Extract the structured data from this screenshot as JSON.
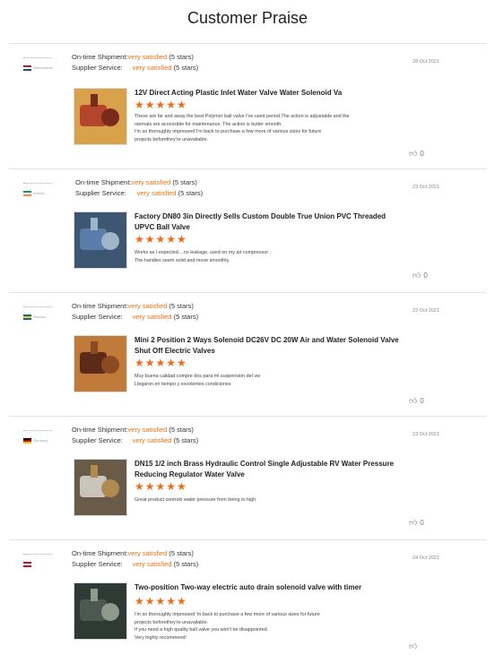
{
  "page": {
    "title": "Customer Praise"
  },
  "labels": {
    "shipment": "On-time Shipment:",
    "service": "Supplier Service:"
  },
  "reviews": [
    {
      "country": "Netherlands",
      "flag": [
        "#ae1c28",
        "#ffffff",
        "#21468b"
      ],
      "date": "28 Oct 2021",
      "shipment": "very satisfied",
      "shipment_stars": "(5 stars)",
      "service": "very satisfied",
      "service_stars": "(5 stars)",
      "product": "12V Direct Acting Plastic Inlet Water Valve Water Solenoid Va",
      "stars": "★★★★★",
      "comment": [
        "These are far and away the best Polymer ball valve I've used period.The action is adjustable and the",
        "nternals are accessible for maintenance. The action is butter smooth.",
        "I'm so thoroughly impressed I'm back to purchase a few more of various sizes for future",
        "projects beforethey're unavailable."
      ],
      "likes": "0"
    },
    {
      "country": "Ireland",
      "flag": [
        "#169b62",
        "#ffffff",
        "#ff883e"
      ],
      "date": "23 Oct 2021",
      "shipment": "very satisfied",
      "shipment_stars": "(5 stars)",
      "service": "very satisfied",
      "service_stars": "(5 stars)",
      "product": "Factory DN80 3in Directly Sells Custom Double True Union PVC Threaded UPVC Ball Valve",
      "stars": "★★★★★",
      "comment": [
        "Works as I expected....no leakage, used on my air compressor .",
        "The handles seem solid and move smoothly."
      ],
      "likes": "0"
    },
    {
      "country": "Sweden",
      "flag": [
        "#006aa7",
        "#fecc00",
        "#006aa7"
      ],
      "date": "22 Oct 2021",
      "shipment": "very satisfied",
      "shipment_stars": "(5 stars)",
      "service": "very satisfied",
      "service_stars": "(5 stars)",
      "product": "Mini 2 Position 2 Ways Solenoid DC26V DC 20W Air and Water Solenoid Valve Shut Off Electric Valves",
      "stars": "★★★★★",
      "comment": [
        "Muy buena calidad compre dos para mi suspension del vw",
        "Llegaron en tiempo y excelentes condiciones"
      ],
      "likes": "0"
    },
    {
      "country": "Germany",
      "flag": [
        "#000000",
        "#dd0000",
        "#ffce00"
      ],
      "date": "23 Oct 2021",
      "shipment": "very satisfied",
      "shipment_stars": "(5 stars)",
      "service": "very satisfied",
      "service_stars": "(5 stars)",
      "product": "DN15 1/2 inch Brass Hydraulic Control Single Adjustable RV Water Pressure Reducing Regulator Water Valve",
      "stars": "★★★★★",
      "comment": [
        "Great product controls water pressure from being to high"
      ],
      "likes": "0"
    },
    {
      "country": "",
      "flag": [
        "#c8102e",
        "#ffffff",
        "#c8102e"
      ],
      "date": "24 Oct 2021",
      "shipment": "very satisfied",
      "shipment_stars": "(5 stars)",
      "service": "very satisfied",
      "service_stars": "(5 stars)",
      "product": "Two-position Two-way electric auto drain solenoid valve with timer",
      "stars": "★★★★★",
      "comment": [
        "I'm so thoroughly impressed 'm back to purchase a few more of various sizes for future",
        "projects beforethey're unavailable.",
        "If you need a high quality ball valve you won't be disappointed.",
        "Very highly recommend!"
      ],
      "likes": ""
    }
  ]
}
